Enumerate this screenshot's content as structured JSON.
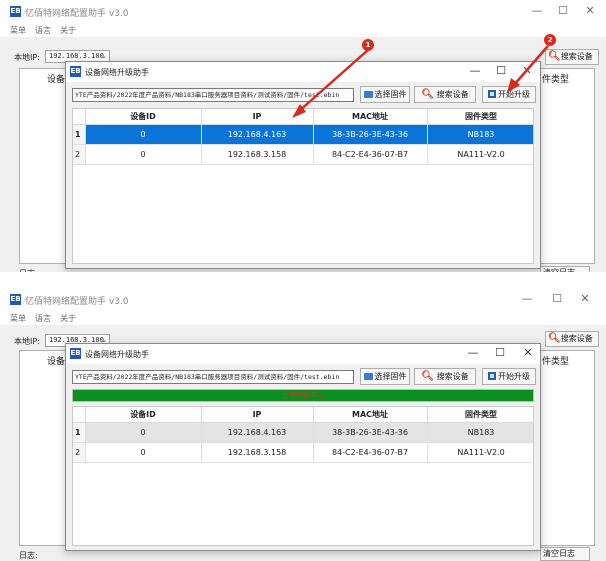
{
  "app": {
    "title": "亿佰特网络配置助手 v3.0",
    "icon_text": "EB",
    "menu": [
      "菜单",
      "语言",
      "关于"
    ],
    "local_ip_label": "本地IP:",
    "local_ip_value": "192.168.3.100",
    "search_button": "搜索设备",
    "bg_column_left": "设备",
    "bg_column_right": "件类型",
    "log_label": "日志:",
    "clear_log_button": "清空日志"
  },
  "dialog": {
    "title": "设备网络升级助手",
    "path": "YTE产品资料/2022年度产品资料/NB183串口服务器项目资料/测试资料/固件/test.ebin",
    "select_firmware_button": "选择固件",
    "search_button": "搜索设备",
    "start_upgrade_button": "开始升级",
    "progress_text": "正在升级中...",
    "progress_fraction": 1.0
  },
  "table": {
    "columns": [
      "设备ID",
      "IP",
      "MAC地址",
      "固件类型"
    ],
    "rows": [
      {
        "num": "1",
        "id": "0",
        "ip": "192.168.4.163",
        "mac": "38-3B-26-3E-43-36",
        "fw": "NB183"
      },
      {
        "num": "2",
        "id": "0",
        "ip": "192.168.3.158",
        "mac": "84-C2-E4-36-07-B7",
        "fw": "NA111-V2.0"
      }
    ]
  },
  "annotations": [
    "1",
    "2"
  ],
  "colors": {
    "selected_row": "#0a74d9",
    "progress": "#0b8f1e",
    "arrow": "#d9281e",
    "brand_icon": "#1e5bb8"
  }
}
